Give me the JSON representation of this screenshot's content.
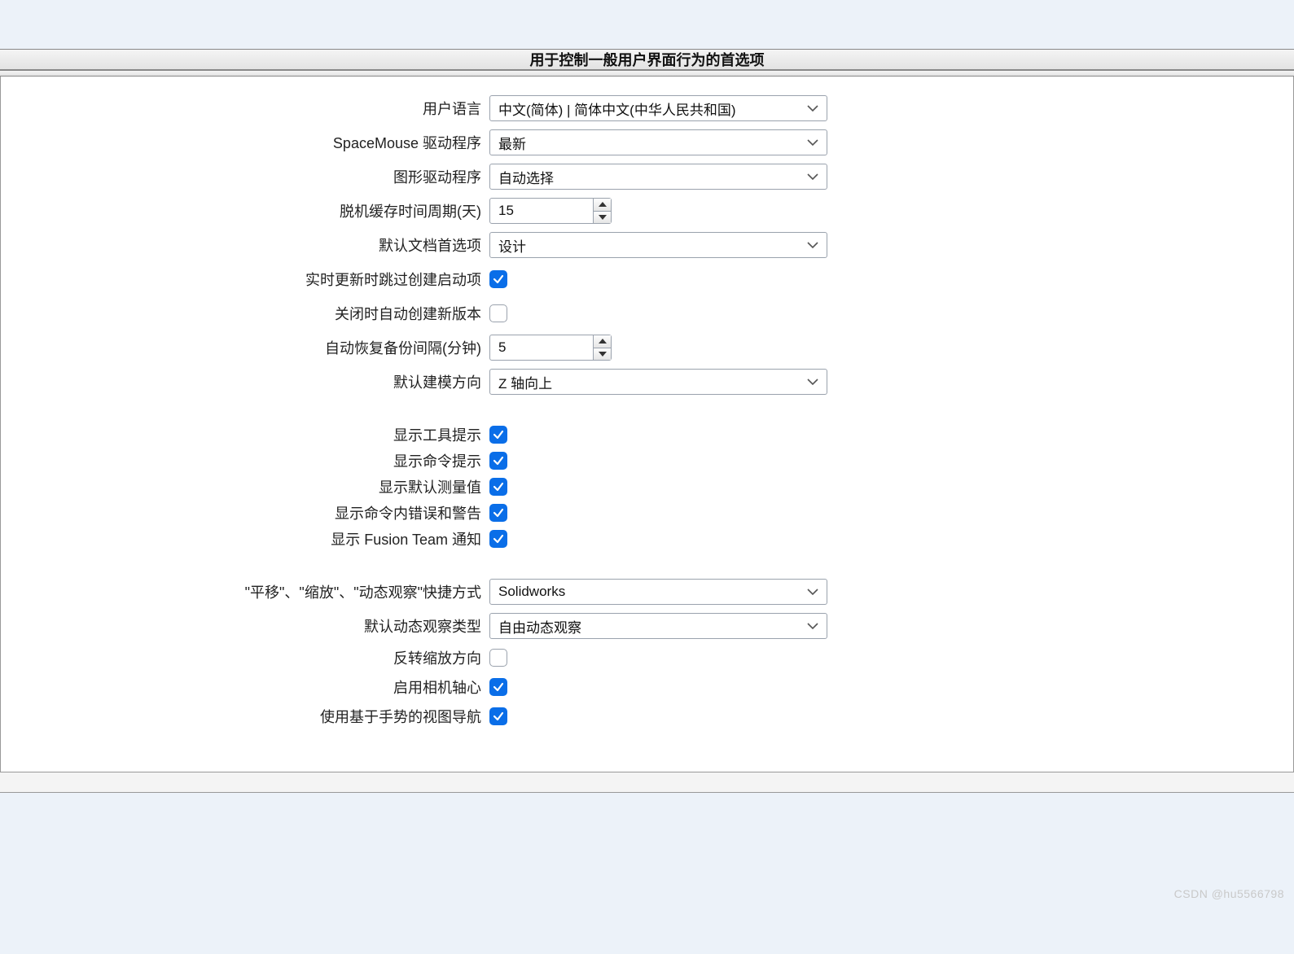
{
  "header": {
    "title": "用于控制一般用户界面行为的首选项"
  },
  "fields": {
    "user_language": {
      "label": "用户语言",
      "value": "中文(简体) | 简体中文(中华人民共和国)"
    },
    "spacemouse_driver": {
      "label": "SpaceMouse 驱动程序",
      "value": "最新"
    },
    "graphics_driver": {
      "label": "图形驱动程序",
      "value": "自动选择"
    },
    "offline_cache_days": {
      "label": "脱机缓存时间周期(天)",
      "value": "15"
    },
    "default_doc_prefs": {
      "label": "默认文档首选项",
      "value": "设计"
    },
    "skip_create_startup": {
      "label": "实时更新时跳过创建启动项",
      "checked": true
    },
    "auto_create_version_on_close": {
      "label": "关闭时自动创建新版本",
      "checked": false
    },
    "auto_backup_minutes": {
      "label": "自动恢复备份间隔(分钟)",
      "value": "5"
    },
    "default_modeling_orientation": {
      "label": "默认建模方向",
      "value": "Z 轴向上"
    },
    "show_tool_tips": {
      "label": "显示工具提示",
      "checked": true
    },
    "show_command_prompt": {
      "label": "显示命令提示",
      "checked": true
    },
    "show_default_measure": {
      "label": "显示默认测量值",
      "checked": true
    },
    "show_command_errors": {
      "label": "显示命令内错误和警告",
      "checked": true
    },
    "show_fusion_team_notif": {
      "label": "显示 Fusion Team 通知",
      "checked": true
    },
    "pan_zoom_orbit_shortcuts": {
      "label": "\"平移\"、\"缩放\"、\"动态观察\"快捷方式",
      "value": "Solidworks"
    },
    "default_orbit_type": {
      "label": "默认动态观察类型",
      "value": "自由动态观察"
    },
    "reverse_zoom": {
      "label": "反转缩放方向",
      "checked": false
    },
    "enable_camera_pivot": {
      "label": "启用相机轴心",
      "checked": true
    },
    "gesture_nav": {
      "label": "使用基于手势的视图导航",
      "checked": true
    }
  },
  "watermark": "CSDN @hu5566798"
}
